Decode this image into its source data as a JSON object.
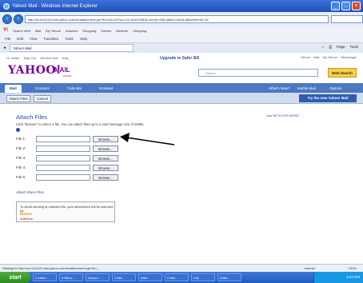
{
  "window": {
    "title": "Yahoo! Mail - Windows Internet Explorer",
    "url": "http://us.mc1143.mail.yahoo.com/dc/attachment.gw?ts=mc1143?ivp=1&.rand=9981&.crumb=d9&.attach=new&.attachments=1#",
    "search_placeholder": ""
  },
  "browser_toolbar": {
    "items": [
      "Search Web",
      "Mail",
      "My Yahoo!",
      "Answers",
      "Shopping",
      "Games",
      "Weather",
      "Shopping"
    ],
    "brand": "Y!"
  },
  "menu": [
    "File",
    "Edit",
    "View",
    "Favorites",
    "Tools",
    "Help"
  ],
  "favorites": {
    "tab_title": "Yahoo! Mail",
    "tools": [
      "Page",
      "Tools"
    ]
  },
  "ymail": {
    "top_nav": [
      "Hi, winter",
      "Sign Out",
      "All-New Mail",
      "Help"
    ],
    "upgrade": "Upgrade to Safer IE6",
    "top_right": [
      "Yahoo!",
      "Mail",
      "My Yahoo!",
      "Messenger"
    ],
    "logo": "YAHOO!",
    "mail": "MAIL",
    "classic": "Classic",
    "search_placeholder": "Search",
    "search_button": "Web Search",
    "tabs": [
      "Mail",
      "Contacts",
      "Calendar",
      "Notepad"
    ],
    "tab_right": [
      "What's New?",
      "Mobile Mail",
      "Options"
    ],
    "actions": {
      "attach_button": "Attach Files",
      "cancel_button": "Cancel",
      "try_new": "Try the new Yahoo! Mail"
    }
  },
  "attach": {
    "title": "Attach Files",
    "help": "Click \"Browse\" to select a file. You can attach files up to a total message size of 25MB.",
    "right_link": "Use BETA FOR MORE",
    "files": [
      {
        "label": "File 1:",
        "browse": "Browse..."
      },
      {
        "label": "File 2:",
        "browse": "Browse..."
      },
      {
        "label": "File 3:",
        "browse": "Browse..."
      },
      {
        "label": "File 4:",
        "browse": "Browse..."
      },
      {
        "label": "File 5:",
        "browse": "Browse..."
      }
    ],
    "more": "Attach More Files",
    "norton_text": "To avoid sending an infected file, your attachment will be scanned by:",
    "norton_brand": "Norton",
    "norton_sub": "AntiVirus"
  },
  "statusbar": {
    "text": "Waiting for http://us.mc1143.mail.yahoo.com/dc/attachment.gw?ts=...",
    "zone": "Internet",
    "zoom": "100%"
  },
  "taskbar": {
    "start": "start",
    "items": [
      "2 Intern...",
      "3 Micro...",
      "Docum...",
      "2 Mic...",
      "Winr...",
      "2 Win...",
      "Cal...",
      "Untitl..."
    ],
    "clock": "3:10 PM"
  },
  "colors": {
    "accent": "#4a78c2",
    "logo": "#7b0099",
    "link": "#2a4d9e"
  }
}
